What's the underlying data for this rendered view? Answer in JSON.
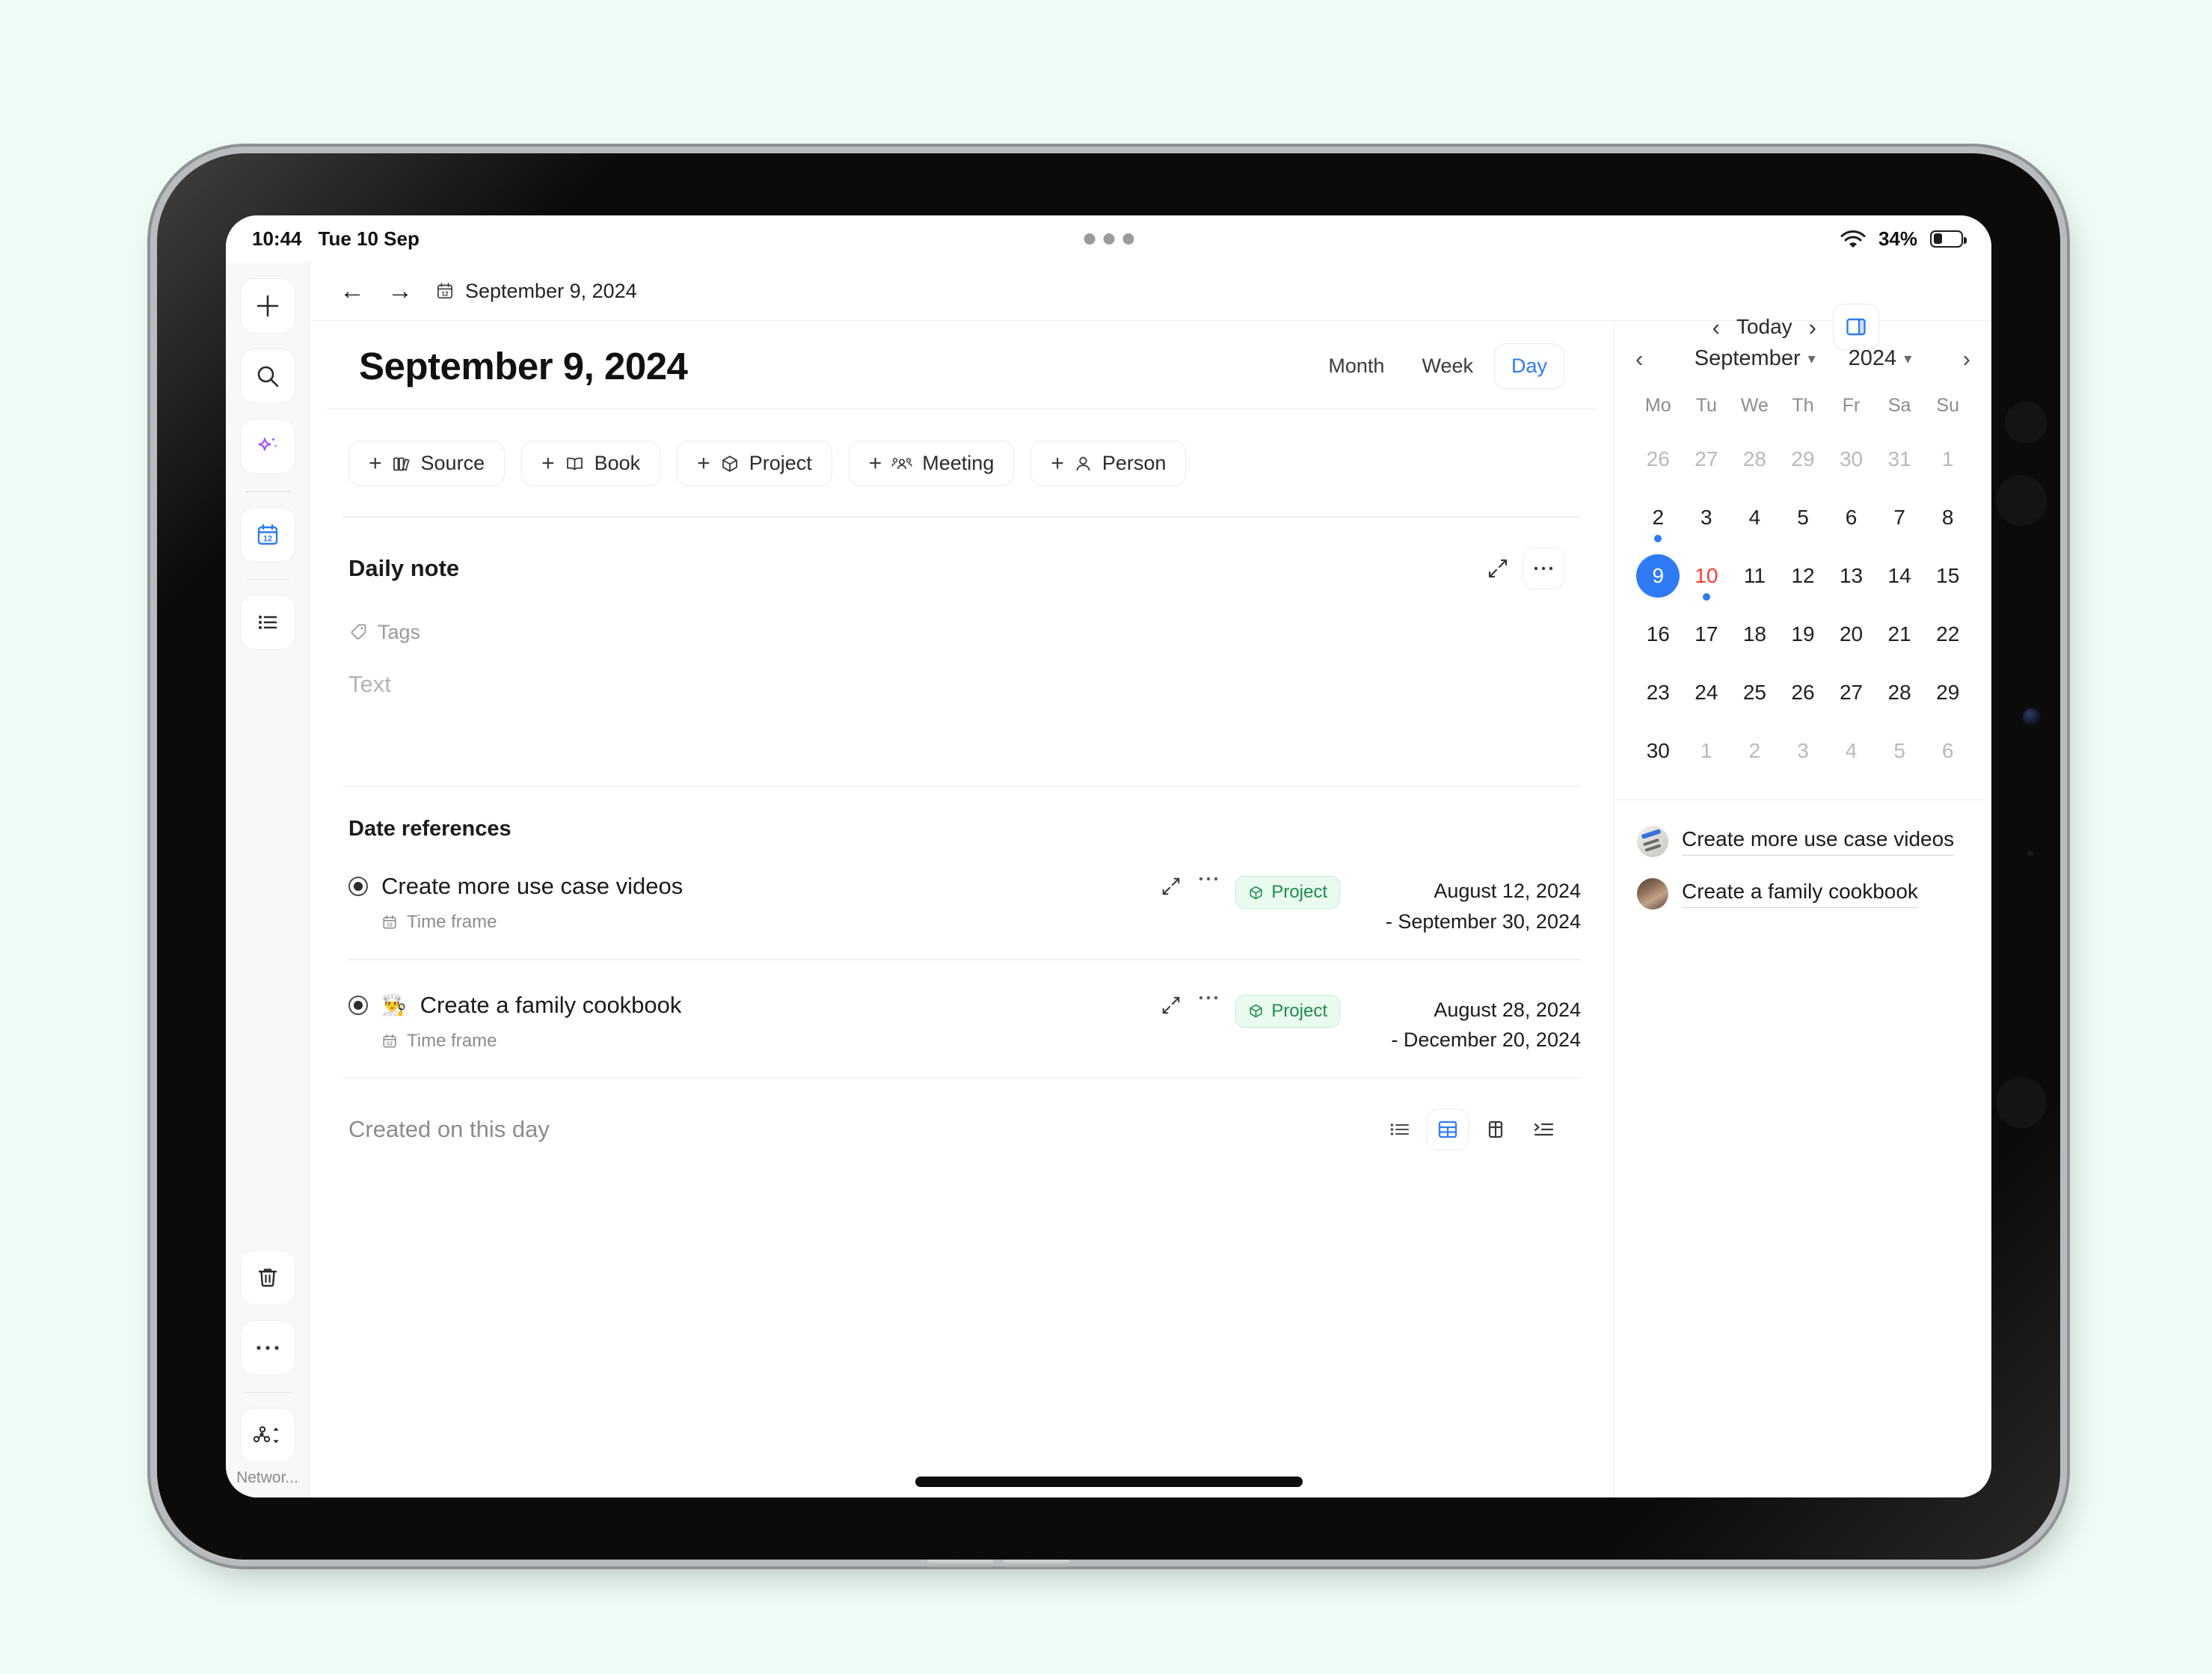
{
  "status_bar": {
    "time": "10:44",
    "date": "Tue 10 Sep",
    "battery_percent": "34%",
    "wifi_icon": "wifi-icon",
    "battery_icon": "battery-icon",
    "multitask_handle": "multitask-handle-icon"
  },
  "rail": {
    "top_items": [
      {
        "name": "new-button",
        "icon": "plus-icon"
      },
      {
        "name": "search-button",
        "icon": "search-icon"
      },
      {
        "name": "ai-assistant-button",
        "icon": "sparkle-icon"
      },
      {
        "name": "calendar-button",
        "icon": "calendar-12-icon"
      },
      {
        "name": "list-button",
        "icon": "bullet-list-icon"
      }
    ],
    "bottom_items": [
      {
        "name": "trash-button",
        "icon": "trash-icon"
      },
      {
        "name": "more-button",
        "icon": "ellipsis-icon"
      },
      {
        "name": "network-switcher-button",
        "icon": "network-icon"
      }
    ],
    "network_label": "Networ..."
  },
  "breadcrumb": {
    "back_icon": "arrow-left-icon",
    "forward_icon": "arrow-right-icon",
    "doc_icon": "calendar-12-icon",
    "title": "September 9, 2024"
  },
  "page": {
    "title": "September 9, 2024",
    "view_switch": {
      "options": [
        "Month",
        "Week",
        "Day"
      ],
      "active": "Day"
    },
    "today_nav": {
      "prev_icon": "chevron-left-icon",
      "label": "Today",
      "next_icon": "chevron-right-icon",
      "panel_toggle_icon": "right-panel-icon"
    }
  },
  "quick_add_chips": [
    {
      "label": "Source",
      "icon": "books-icon"
    },
    {
      "label": "Book",
      "icon": "open-book-icon"
    },
    {
      "label": "Project",
      "icon": "cube-icon"
    },
    {
      "label": "Meeting",
      "icon": "people-icon"
    },
    {
      "label": "Person",
      "icon": "person-icon"
    }
  ],
  "daily_note": {
    "title": "Daily note",
    "expand_icon": "expand-arrows-icon",
    "more_icon": "ellipsis-icon",
    "tags_label": "Tags",
    "tags_icon": "tag-icon",
    "text_placeholder": "Text"
  },
  "date_references": {
    "title": "Date references",
    "rows": [
      {
        "name": "Create more use case videos",
        "emoji": "",
        "sub_label": "Time frame",
        "sub_icon": "calendar-12-icon",
        "expand_icon": "expand-arrows-icon",
        "more_icon": "ellipsis-icon",
        "badge": "Project",
        "badge_icon": "cube-icon",
        "date_start": "August 12, 2024",
        "date_end": "- September 30, 2024"
      },
      {
        "name": "Create a family cookbook",
        "emoji": "👨‍🍳",
        "sub_label": "Time frame",
        "sub_icon": "calendar-12-icon",
        "expand_icon": "expand-arrows-icon",
        "more_icon": "ellipsis-icon",
        "badge": "Project",
        "badge_icon": "cube-icon",
        "date_start": "August 28, 2024",
        "date_end": "- December 20, 2024"
      }
    ]
  },
  "created_on_this_day": {
    "title": "Created on this day",
    "views": [
      {
        "name": "list-view-button",
        "icon": "list-icon",
        "active": false
      },
      {
        "name": "grid-view-button",
        "icon": "grid-icon",
        "active": true
      },
      {
        "name": "gallery-view-button",
        "icon": "columns-icon",
        "active": false
      },
      {
        "name": "outline-view-button",
        "icon": "outline-icon",
        "active": false
      }
    ]
  },
  "right_panel": {
    "calendar": {
      "prev_icon": "chevron-left-icon",
      "next_icon": "chevron-right-icon",
      "month": "September",
      "year": "2024",
      "weekday_headers": [
        "Mo",
        "Tu",
        "We",
        "Th",
        "Fr",
        "Sa",
        "Su"
      ],
      "weeks": [
        [
          {
            "d": "26",
            "muted": true
          },
          {
            "d": "27",
            "muted": true
          },
          {
            "d": "28",
            "muted": true
          },
          {
            "d": "29",
            "muted": true
          },
          {
            "d": "30",
            "muted": true
          },
          {
            "d": "31",
            "muted": true
          },
          {
            "d": "1",
            "muted": true
          }
        ],
        [
          {
            "d": "2",
            "dot": true
          },
          {
            "d": "3"
          },
          {
            "d": "4"
          },
          {
            "d": "5"
          },
          {
            "d": "6"
          },
          {
            "d": "7"
          },
          {
            "d": "8"
          }
        ],
        [
          {
            "d": "9",
            "selected": true
          },
          {
            "d": "10",
            "today": true,
            "dot": true
          },
          {
            "d": "11"
          },
          {
            "d": "12"
          },
          {
            "d": "13"
          },
          {
            "d": "14"
          },
          {
            "d": "15"
          }
        ],
        [
          {
            "d": "16"
          },
          {
            "d": "17"
          },
          {
            "d": "18"
          },
          {
            "d": "19"
          },
          {
            "d": "20"
          },
          {
            "d": "21"
          },
          {
            "d": "22"
          }
        ],
        [
          {
            "d": "23"
          },
          {
            "d": "24"
          },
          {
            "d": "25"
          },
          {
            "d": "26"
          },
          {
            "d": "27"
          },
          {
            "d": "28"
          },
          {
            "d": "29"
          }
        ],
        [
          {
            "d": "30"
          },
          {
            "d": "1",
            "muted": true
          },
          {
            "d": "2",
            "muted": true
          },
          {
            "d": "3",
            "muted": true
          },
          {
            "d": "4",
            "muted": true
          },
          {
            "d": "5",
            "muted": true
          },
          {
            "d": "6",
            "muted": true
          }
        ]
      ]
    },
    "links": [
      {
        "label": "Create more use case videos",
        "avatar": "av1"
      },
      {
        "label": "Create a family cookbook",
        "avatar": "av2"
      }
    ]
  },
  "colors": {
    "accent_blue": "#2f7bf6",
    "today_red": "#ff3b30",
    "badge_green_text": "#1f8b4d",
    "badge_green_bg": "#e9fbef",
    "page_bg": "#eefbf7",
    "sidebar_bg": "#f8f8f7"
  }
}
